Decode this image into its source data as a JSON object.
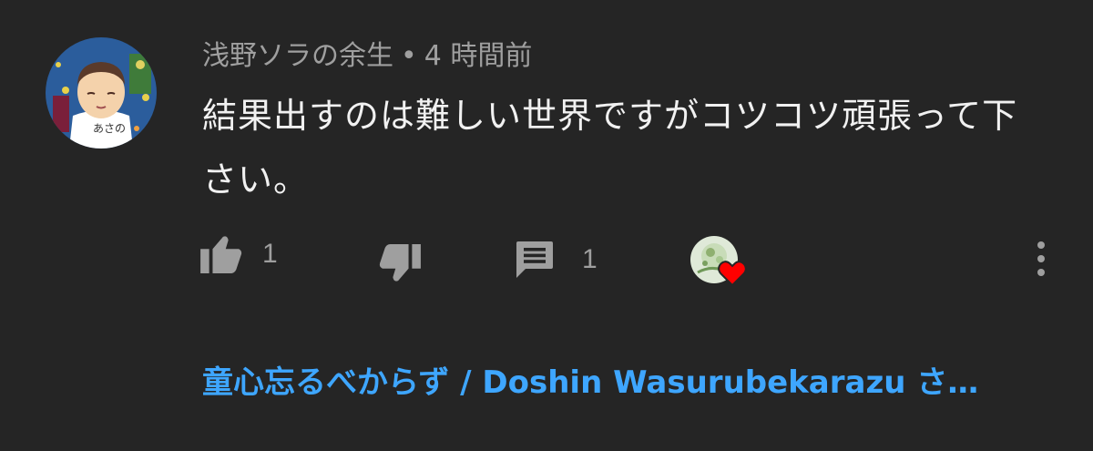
{
  "comment": {
    "author": "浅野ソラの余生",
    "separator": "•",
    "time": "4 時間前",
    "text": "結果出すのは難しい世界ですがコツコツ頑張って下さい。"
  },
  "actions": {
    "like_icon": "thumb-up-icon",
    "like_count": "1",
    "dislike_icon": "thumb-down-icon",
    "reply_icon": "reply-icon",
    "reply_count": "1",
    "creator_heart_icon": "heart-icon",
    "heart_color": "#ff0000",
    "more_icon": "more-vert-icon"
  },
  "replies_link": {
    "text": "童心忘るべからず / Doshin Wasurubekarazu さ…",
    "color": "#3ea6ff"
  },
  "theme": {
    "background": "#252525",
    "text_primary": "#f1f1f1",
    "text_secondary": "#9f9f9f"
  }
}
